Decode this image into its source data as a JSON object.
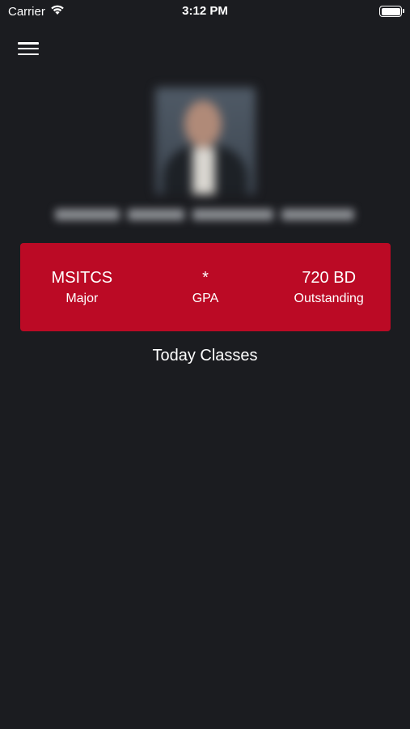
{
  "status_bar": {
    "carrier": "Carrier",
    "time": "3:12 PM"
  },
  "stats": {
    "major": {
      "value": "MSITCS",
      "label": "Major"
    },
    "gpa": {
      "value": "*",
      "label": "GPA"
    },
    "outstanding": {
      "value": "720 BD",
      "label": "Outstanding"
    }
  },
  "colors": {
    "background": "#1b1c20",
    "card": "#bb0a25",
    "text": "#ffffff"
  },
  "sections": {
    "today_classes": "Today Classes"
  }
}
